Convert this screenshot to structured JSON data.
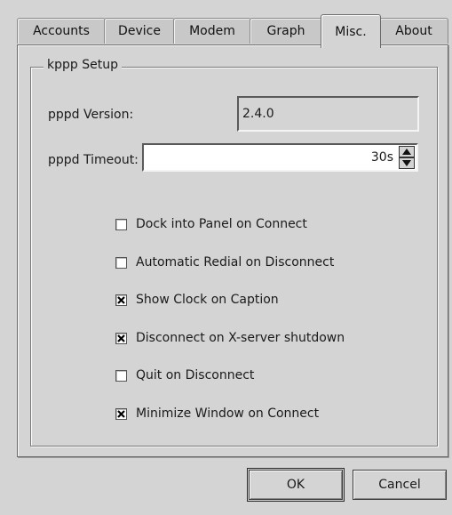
{
  "tabs": [
    {
      "label": "Accounts",
      "active": false
    },
    {
      "label": "Device",
      "active": false
    },
    {
      "label": "Modem",
      "active": false
    },
    {
      "label": "Graph",
      "active": false
    },
    {
      "label": "Misc.",
      "active": true
    },
    {
      "label": "About",
      "active": false
    }
  ],
  "group": {
    "title": "kppp Setup"
  },
  "pppd_version": {
    "label": "pppd Version:",
    "value": "2.4.0"
  },
  "pppd_timeout": {
    "label": "pppd Timeout:",
    "value": "30s"
  },
  "options": [
    {
      "label": "Dock into Panel on Connect",
      "checked": false
    },
    {
      "label": "Automatic Redial on Disconnect",
      "checked": false
    },
    {
      "label": "Show Clock on Caption",
      "checked": true
    },
    {
      "label": "Disconnect on X-server shutdown",
      "checked": true
    },
    {
      "label": "Quit on Disconnect",
      "checked": false
    },
    {
      "label": "Minimize Window on Connect",
      "checked": true
    }
  ],
  "buttons": {
    "ok": "OK",
    "cancel": "Cancel"
  },
  "icons": {
    "check": "x-mark-icon",
    "spin_up": "arrow-up-icon",
    "spin_down": "arrow-down-icon"
  }
}
